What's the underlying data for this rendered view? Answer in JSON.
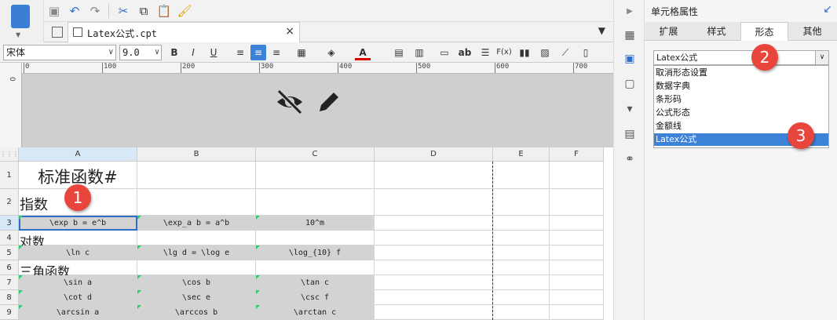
{
  "toolbar": {
    "save": "save-icon",
    "undo": "undo-icon",
    "redo": "redo-icon",
    "cut": "cut-icon",
    "copy": "copy-icon",
    "paste": "paste-icon",
    "format_painter": "brush-icon"
  },
  "tab": {
    "label": "Latex公式.cpt",
    "close": "×"
  },
  "format": {
    "font": "宋体",
    "size": "9.0",
    "bold": "B",
    "italic": "I",
    "underline": "U",
    "text_sample": "ab",
    "formula": "F(x)"
  },
  "ruler": {
    "marks": [
      "0",
      "100",
      "200",
      "300",
      "400",
      "500",
      "600",
      "700"
    ],
    "left_mark": "0"
  },
  "grid": {
    "columns": [
      "A",
      "B",
      "C",
      "D",
      "E",
      "F"
    ],
    "rows": [
      "1",
      "2",
      "3",
      "4",
      "5",
      "6",
      "7",
      "8",
      "9"
    ],
    "r1": {
      "a": "标准函数#"
    },
    "r2": {
      "a": "指数"
    },
    "r3": {
      "a": "\\exp b = e^b",
      "b": "\\exp_a b = a^b",
      "c": "10^m"
    },
    "r4": {
      "a": "对数"
    },
    "r5": {
      "a": "\\ln c",
      "b": "\\lg d = \\log e",
      "c": "\\log_{10} f"
    },
    "r6": {
      "a": "三角函数"
    },
    "r7": {
      "a": "\\sin a",
      "b": "\\cos b",
      "c": "\\tan c"
    },
    "r8": {
      "a": "\\cot d",
      "b": "\\sec e",
      "c": "\\csc f"
    },
    "r9": {
      "a": "\\arcsin a",
      "b": "\\arccos b",
      "c": "\\arctan c"
    }
  },
  "badges": {
    "one": "1",
    "two": "2",
    "three": "3"
  },
  "panel": {
    "title": "单元格属性",
    "tabs": [
      "扩展",
      "样式",
      "形态",
      "其他"
    ],
    "select_value": "Latex公式",
    "options": [
      "取消形态设置",
      "数据字典",
      "条形码",
      "公式形态",
      "金额线",
      "Latex公式"
    ]
  },
  "colors": {
    "accent": "#3c82d8",
    "badge": "#e8453c",
    "latex_cell": "#d3d3d3",
    "marker": "#2ecc71"
  }
}
